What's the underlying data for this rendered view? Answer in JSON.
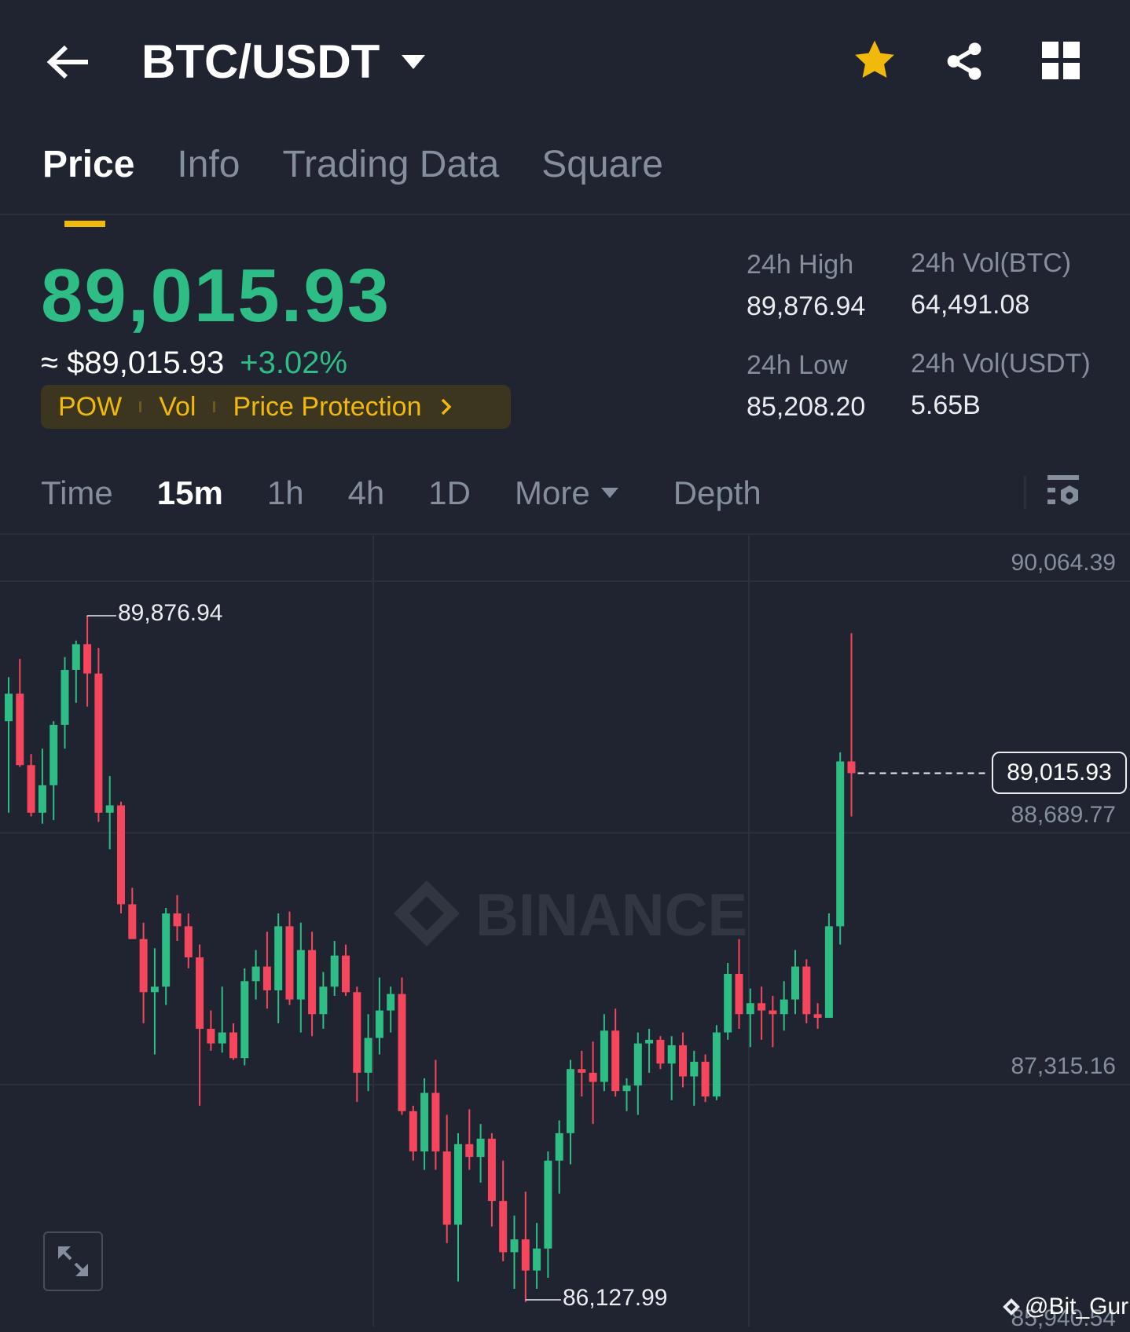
{
  "header": {
    "pair": "BTC/USDT",
    "icons": [
      "back-arrow-icon",
      "dropdown-caret-icon",
      "star-icon",
      "share-icon",
      "grid-menu-icon"
    ]
  },
  "tabs": [
    {
      "label": "Price",
      "active": true
    },
    {
      "label": "Info"
    },
    {
      "label": "Trading Data"
    },
    {
      "label": "Square"
    }
  ],
  "ticker": {
    "last_price": "89,015.93",
    "fiat_price": "≈ $89,015.93",
    "change": "+3.02%",
    "tags": [
      "POW",
      "Vol",
      "Price Protection"
    ],
    "stats": [
      {
        "label": "24h High",
        "value": "89,876.94"
      },
      {
        "label": "24h Vol(BTC)",
        "value": "64,491.08"
      },
      {
        "label": "24h Low",
        "value": "85,208.20"
      },
      {
        "label": "24h Vol(USDT)",
        "value": "5.65B"
      }
    ]
  },
  "intervals": {
    "items": [
      "Time",
      "15m",
      "1h",
      "4h",
      "1D",
      "More",
      "Depth"
    ],
    "active": "15m"
  },
  "colors": {
    "up": "#2ebd85",
    "down": "#f6465d",
    "accent": "#f0b90b",
    "bg": "#1f2430"
  },
  "chart_data": {
    "type": "candlestick",
    "interval": "15m",
    "y_axis_labels": [
      "90,064.39",
      "88,689.77",
      "87,315.16",
      "85,940.54"
    ],
    "y_axis_values": [
      90064.39,
      88689.77,
      87315.16,
      85940.54
    ],
    "high_marker": "89,876.94",
    "low_marker": "86,127.99",
    "current_price_label": "89,015.93",
    "current_price": 89015.93,
    "watermark": "BINANCE",
    "credit": "@Bit_Guru",
    "ohlc": [
      [
        89300,
        89540,
        88800,
        89450
      ],
      [
        89450,
        89640,
        89050,
        89060
      ],
      [
        89060,
        89120,
        88780,
        88800
      ],
      [
        88800,
        89150,
        88740,
        88950
      ],
      [
        88950,
        89300,
        88760,
        89280
      ],
      [
        89280,
        89650,
        89150,
        89580
      ],
      [
        89580,
        89740,
        89400,
        89720
      ],
      [
        89720,
        89876.94,
        89380,
        89560
      ],
      [
        89560,
        89700,
        88750,
        88800
      ],
      [
        88800,
        89000,
        88600,
        88840
      ],
      [
        88840,
        88860,
        88250,
        88300
      ],
      [
        88300,
        88390,
        88130,
        88110
      ],
      [
        88110,
        88200,
        87650,
        87820
      ],
      [
        87820,
        88060,
        87480,
        87850
      ],
      [
        87850,
        88280,
        87750,
        88250
      ],
      [
        88250,
        88350,
        88100,
        88180
      ],
      [
        88180,
        88250,
        87950,
        88010
      ],
      [
        88010,
        88080,
        87200,
        87620
      ],
      [
        87620,
        87720,
        87500,
        87540
      ],
      [
        87540,
        87850,
        87490,
        87600
      ],
      [
        87600,
        87650,
        87450,
        87460
      ],
      [
        87460,
        87950,
        87420,
        87880
      ],
      [
        87880,
        88050,
        87780,
        87960
      ],
      [
        87960,
        88150,
        87730,
        87830
      ],
      [
        87830,
        88250,
        87650,
        88180
      ],
      [
        88180,
        88260,
        87750,
        87780
      ],
      [
        87780,
        88200,
        87600,
        88050
      ],
      [
        88050,
        88150,
        87580,
        87700
      ],
      [
        87700,
        87930,
        87620,
        87850
      ],
      [
        87850,
        88100,
        87800,
        88020
      ],
      [
        88020,
        88080,
        87800,
        87820
      ],
      [
        87820,
        87850,
        87220,
        87380
      ],
      [
        87380,
        87700,
        87280,
        87570
      ],
      [
        87570,
        87900,
        87480,
        87720
      ],
      [
        87720,
        87850,
        87600,
        87810
      ],
      [
        87810,
        87900,
        87150,
        87170
      ],
      [
        87170,
        87200,
        86900,
        86950
      ],
      [
        86950,
        87350,
        86850,
        87270
      ],
      [
        87270,
        87450,
        86850,
        86950
      ],
      [
        86950,
        87150,
        86450,
        86550
      ],
      [
        86550,
        87050,
        86240,
        86990
      ],
      [
        86990,
        87180,
        86850,
        86920
      ],
      [
        86920,
        87100,
        86780,
        87020
      ],
      [
        87020,
        87050,
        86540,
        86680
      ],
      [
        86680,
        86900,
        86350,
        86400
      ],
      [
        86400,
        86600,
        86200,
        86470
      ],
      [
        86470,
        86730,
        86127.99,
        86300
      ],
      [
        86300,
        86560,
        86200,
        86420
      ],
      [
        86420,
        86950,
        86260,
        86900
      ],
      [
        86900,
        87120,
        86720,
        87050
      ],
      [
        87050,
        87450,
        86880,
        87400
      ],
      [
        87400,
        87500,
        87250,
        87380
      ],
      [
        87380,
        87550,
        87100,
        87330
      ],
      [
        87330,
        87700,
        87280,
        87610
      ],
      [
        87610,
        87730,
        87250,
        87280
      ],
      [
        87280,
        87350,
        87170,
        87310
      ],
      [
        87310,
        87600,
        87150,
        87540
      ],
      [
        87540,
        87620,
        87380,
        87560
      ],
      [
        87560,
        87580,
        87400,
        87430
      ],
      [
        87430,
        87580,
        87230,
        87530
      ],
      [
        87530,
        87600,
        87300,
        87360
      ],
      [
        87360,
        87500,
        87200,
        87440
      ],
      [
        87440,
        87480,
        87220,
        87250
      ],
      [
        87250,
        87640,
        87230,
        87600
      ],
      [
        87600,
        87980,
        87560,
        87920
      ],
      [
        87920,
        88110,
        87620,
        87700
      ],
      [
        87700,
        87840,
        87520,
        87760
      ],
      [
        87760,
        87850,
        87560,
        87720
      ],
      [
        87720,
        87800,
        87520,
        87700
      ],
      [
        87700,
        87880,
        87610,
        87780
      ],
      [
        87780,
        88050,
        87700,
        87960
      ],
      [
        87960,
        88000,
        87650,
        87700
      ],
      [
        87700,
        87760,
        87620,
        87680
      ],
      [
        87680,
        88250,
        87680,
        88180
      ],
      [
        88180,
        89130,
        88080,
        89080
      ],
      [
        89080,
        89780,
        88780,
        89015.93
      ]
    ]
  }
}
